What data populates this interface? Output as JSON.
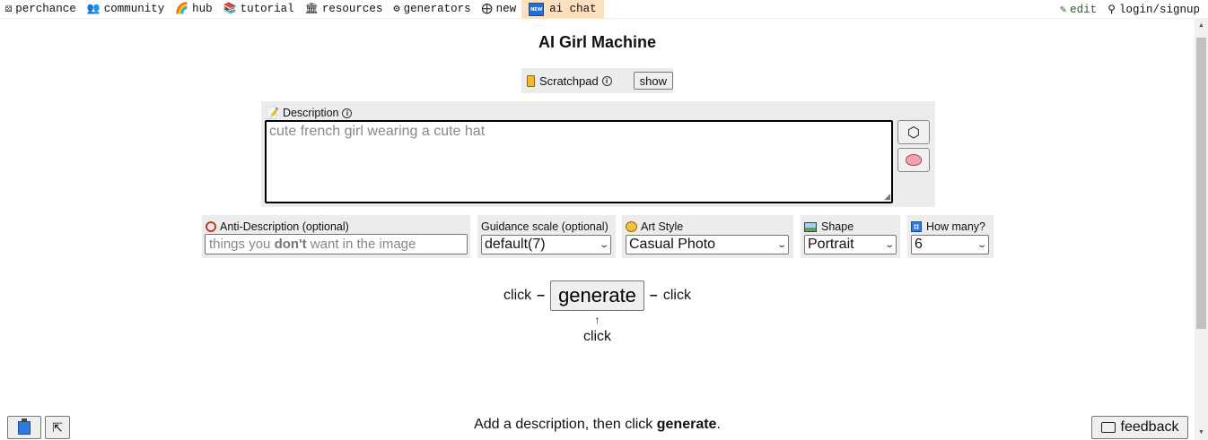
{
  "nav": {
    "items": [
      {
        "label": "perchance",
        "icon": "frame-icon"
      },
      {
        "label": "community",
        "icon": "people-icon"
      },
      {
        "label": "hub",
        "icon": "rainbow-icon"
      },
      {
        "label": "tutorial",
        "icon": "books-icon"
      },
      {
        "label": "resources",
        "icon": "building-icon"
      },
      {
        "label": "generators",
        "icon": "gears-icon"
      },
      {
        "label": "new",
        "icon": "plus-circle-icon"
      }
    ],
    "ai_chat": {
      "label": "ai chat",
      "badge": "NEW"
    },
    "edit": "edit",
    "login": "login/signup"
  },
  "page": {
    "title": "AI Girl Machine",
    "scratchpad": {
      "label": "Scratchpad",
      "show": "show"
    },
    "description": {
      "label": "Description",
      "placeholder": "cute french girl wearing a cute hat"
    },
    "anti_description": {
      "label": "Anti-Description (optional)",
      "placeholder_pre": "things you",
      "placeholder_bold": "don't",
      "placeholder_post": "want in the image"
    },
    "guidance": {
      "label": "Guidance scale (optional)",
      "value": "default(7)"
    },
    "art_style": {
      "label": "Art Style",
      "value": "Casual Photo"
    },
    "shape": {
      "label": "Shape",
      "value": "Portrait"
    },
    "how_many": {
      "label": "How many?",
      "value": "6"
    },
    "generate": {
      "label": "generate",
      "left": "click",
      "right": "click",
      "below": "click"
    },
    "status": {
      "prefix": "Add a description, then click",
      "bold": "generate",
      "suffix": "."
    },
    "feedback": "feedback"
  },
  "colors": {
    "accent_tab": "#fde0bf",
    "panel_bg": "#ececec",
    "edit_link": "#1c6e1c"
  }
}
